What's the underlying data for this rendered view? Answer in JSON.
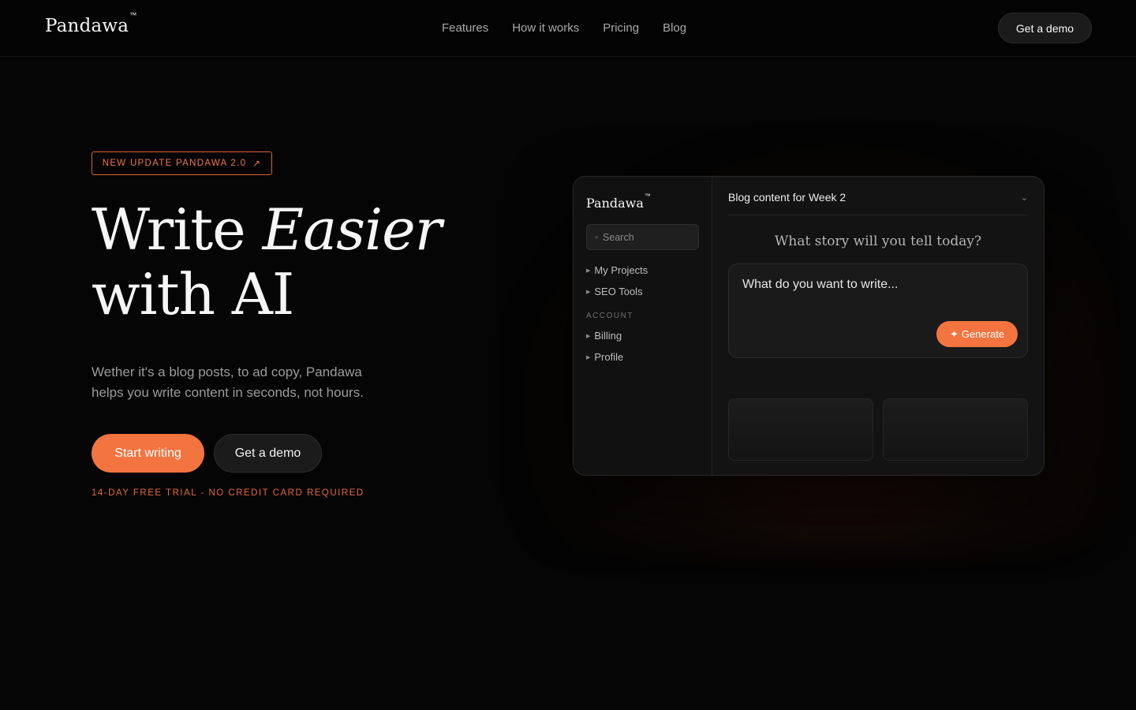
{
  "header": {
    "logo": "Pandawa",
    "trademark": "™",
    "nav": [
      "Features",
      "How it works",
      "Pricing",
      "Blog"
    ],
    "cta": "Get a demo"
  },
  "hero": {
    "badge": "NEW UPDATE PANDAWA 2.0",
    "badge_icon": "arrow-up-right-icon",
    "title_line1_plain": "Write ",
    "title_line1_em": "Easier",
    "title_line2": "with AI",
    "subtitle": "Wether it's a blog posts, to ad copy, Pandawa helps you write content in seconds, not hours.",
    "primary_cta": "Start writing",
    "secondary_cta": "Get a demo",
    "trial_note": "14-DAY FREE TRIAL - NO CREDIT CARD REQUIRED"
  },
  "app": {
    "logo": "Pandawa",
    "trademark": "™",
    "search_placeholder": "Search",
    "side_items": [
      "My Projects",
      "SEO Tools"
    ],
    "account_heading": "ACCOUNT",
    "account_items": [
      "Billing",
      "Profile"
    ],
    "doc_title": "Blog content for Week 2",
    "prompt_heading": "What story will you tell today?",
    "prompt_placeholder": "What do you want to write...",
    "generate_label": "Generate",
    "generate_icon": "sparkle-icon"
  },
  "colors": {
    "accent": "#f47440",
    "background": "#050505"
  }
}
